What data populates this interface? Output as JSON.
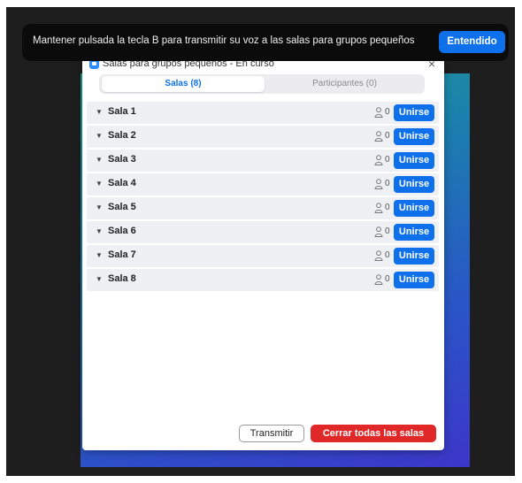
{
  "banner": {
    "message": "Mantener pulsada la tecla B para transmitir su voz a las salas para grupos pequeños",
    "button_label": "Entendido"
  },
  "dialog": {
    "title": "Salas para grupos pequeños - En curso",
    "close_glyph": "×",
    "tabs": [
      {
        "label": "Salas (8)",
        "active": true
      },
      {
        "label": "Participantes (0)",
        "active": false
      }
    ],
    "rooms": [
      {
        "name": "Sala 1",
        "count": "0",
        "join_label": "Unirse"
      },
      {
        "name": "Sala 2",
        "count": "0",
        "join_label": "Unirse"
      },
      {
        "name": "Sala 3",
        "count": "0",
        "join_label": "Unirse"
      },
      {
        "name": "Sala 4",
        "count": "0",
        "join_label": "Unirse"
      },
      {
        "name": "Sala 5",
        "count": "0",
        "join_label": "Unirse"
      },
      {
        "name": "Sala 6",
        "count": "0",
        "join_label": "Unirse"
      },
      {
        "name": "Sala 7",
        "count": "0",
        "join_label": "Unirse"
      },
      {
        "name": "Sala 8",
        "count": "0",
        "join_label": "Unirse"
      }
    ],
    "footer": {
      "broadcast_label": "Transmitir",
      "close_all_label": "Cerrar todas las salas"
    }
  },
  "colors": {
    "accent": "#0e71eb",
    "danger": "#e02828",
    "stage_background": "#1e1e1e"
  },
  "icons": {
    "app": "zoom-app-icon",
    "caret": "caret-down-icon",
    "participants": "person-icon"
  }
}
